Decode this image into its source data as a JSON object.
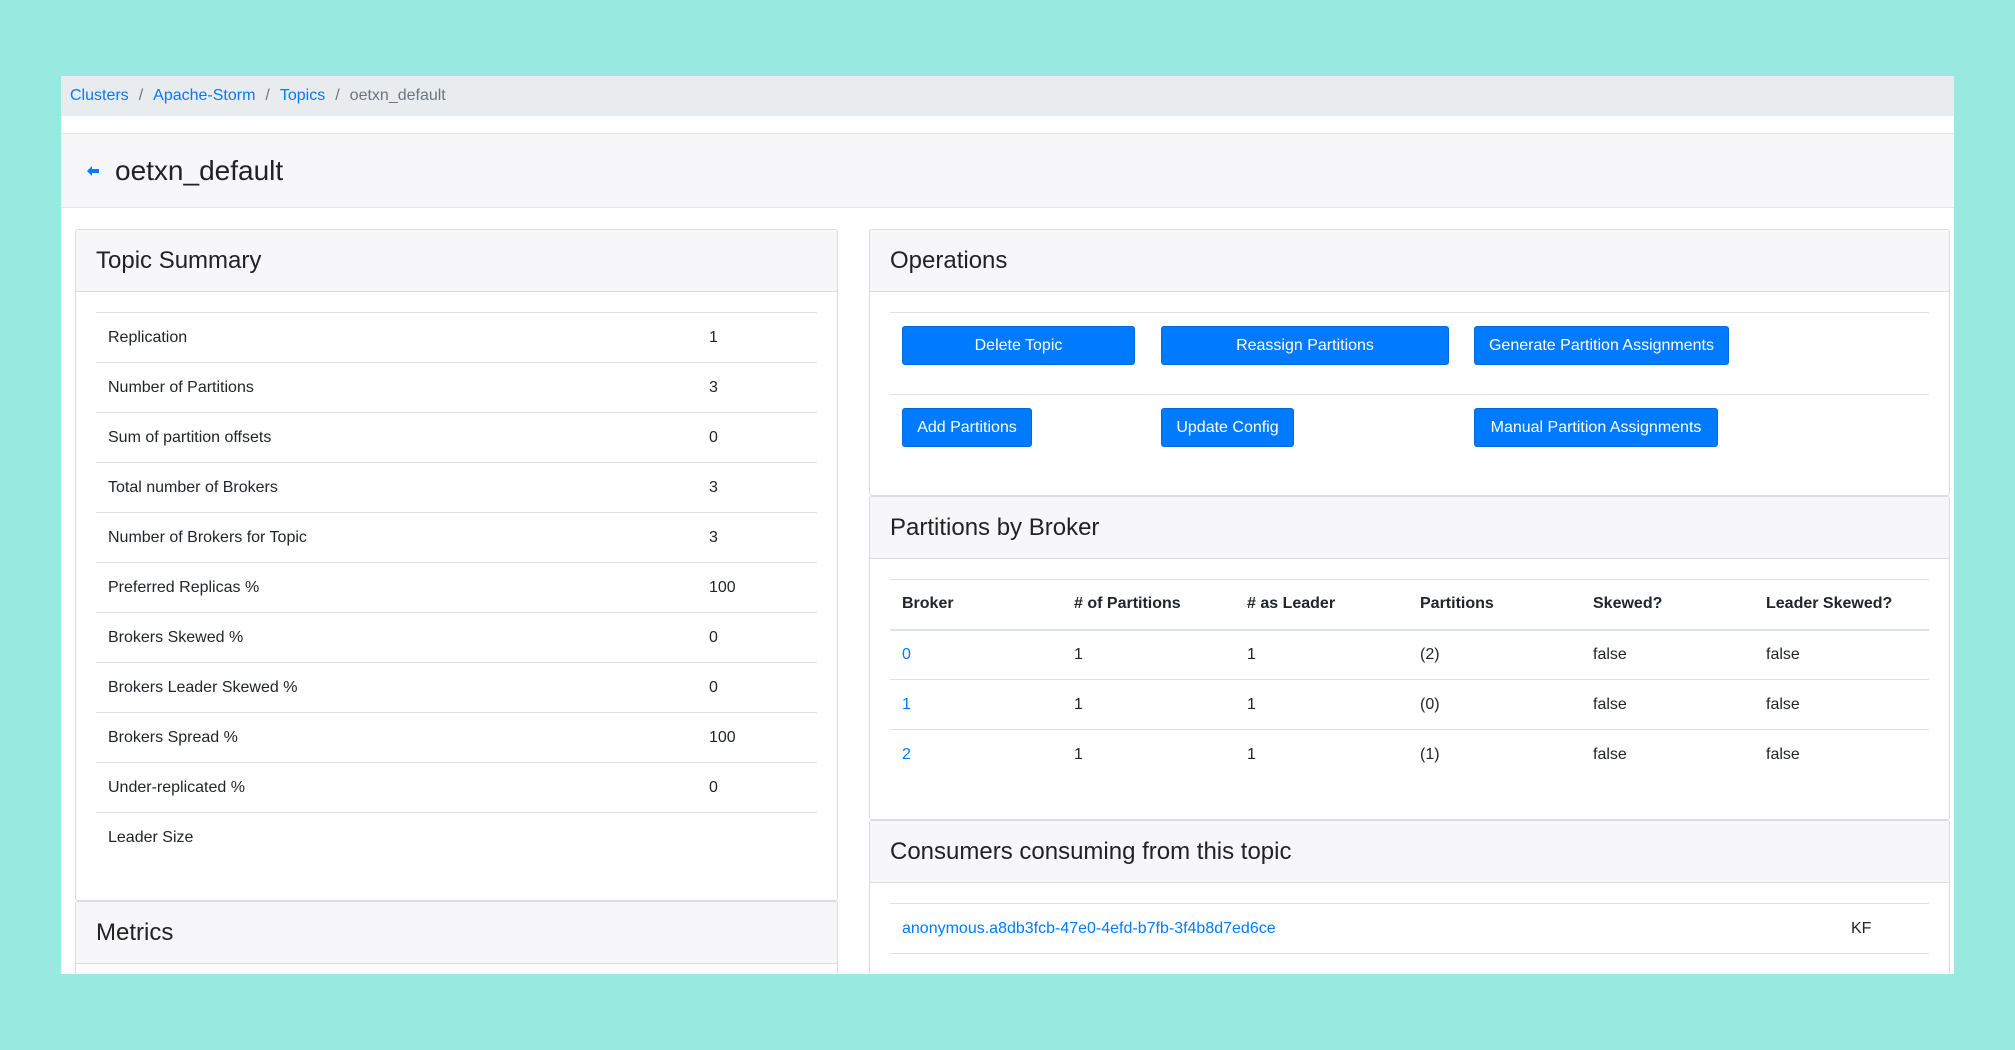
{
  "breadcrumb": {
    "items": [
      "Clusters",
      "Apache-Storm",
      "Topics"
    ],
    "current": "oetxn_default",
    "separator": "/"
  },
  "page": {
    "back_icon": "arrow-left-icon",
    "title": "oetxn_default"
  },
  "topic_summary": {
    "title": "Topic Summary",
    "rows": [
      {
        "label": "Replication",
        "value": "1"
      },
      {
        "label": "Number of Partitions",
        "value": "3"
      },
      {
        "label": "Sum of partition offsets",
        "value": "0"
      },
      {
        "label": "Total number of Brokers",
        "value": "3"
      },
      {
        "label": "Number of Brokers for Topic",
        "value": "3"
      },
      {
        "label": "Preferred Replicas %",
        "value": "100"
      },
      {
        "label": "Brokers Skewed %",
        "value": "0"
      },
      {
        "label": "Brokers Leader Skewed %",
        "value": "0"
      },
      {
        "label": "Brokers Spread %",
        "value": "100"
      },
      {
        "label": "Under-replicated %",
        "value": "0"
      },
      {
        "label": "Leader Size",
        "value": ""
      }
    ]
  },
  "metrics": {
    "title": "Metrics"
  },
  "operations": {
    "title": "Operations",
    "delete_topic": "Delete Topic",
    "reassign_partitions": "Reassign Partitions",
    "generate_assignments": "Generate Partition Assignments",
    "add_partitions": "Add Partitions",
    "update_config": "Update Config",
    "manual_assignments": "Manual Partition Assignments"
  },
  "partitions_by_broker": {
    "title": "Partitions by Broker",
    "columns": [
      "Broker",
      "# of Partitions",
      "# as Leader",
      "Partitions",
      "Skewed?",
      "Leader Skewed?"
    ],
    "rows": [
      [
        "0",
        "1",
        "1",
        "(2)",
        "false",
        "false"
      ],
      [
        "1",
        "1",
        "1",
        "(0)",
        "false",
        "false"
      ],
      [
        "2",
        "1",
        "1",
        "(1)",
        "false",
        "false"
      ]
    ]
  },
  "consumers": {
    "title": "Consumers consuming from this topic",
    "rows": [
      {
        "name": "anonymous.a8db3fcb-47e0-4efd-b7fb-3f4b8d7ed6ce",
        "type": "KF"
      }
    ]
  },
  "colors": {
    "background": "#98e9e0",
    "primary": "#007bff",
    "header_bg": "#f7f7f9",
    "breadcrumb_bg": "#e9ecef"
  }
}
